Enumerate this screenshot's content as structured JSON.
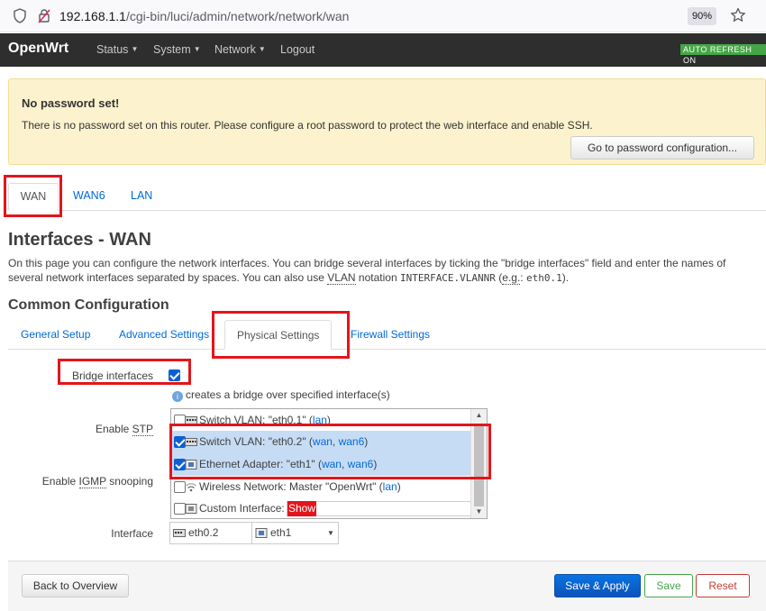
{
  "browser": {
    "url_host": "192.168.1.1",
    "url_path": "/cgi-bin/luci/admin/network/network/wan",
    "zoom": "90%"
  },
  "nav": {
    "brand": "OpenWrt",
    "menu": [
      "Status",
      "System",
      "Network",
      "Logout"
    ],
    "auto_refresh": "AUTO REFRESH ON"
  },
  "alert": {
    "title": "No password set!",
    "message": "There is no password set on this router. Please configure a root password to protect the web interface and enable SSH.",
    "button": "Go to password configuration..."
  },
  "interface_tabs": [
    "WAN",
    "WAN6",
    "LAN"
  ],
  "page": {
    "title": "Interfaces - WAN",
    "desc_1": "On this page you can configure the network interfaces. You can bridge several interfaces by ticking the \"bridge interfaces\" field and enter the names of",
    "desc_2a": "several network interfaces separated by spaces. You can also use ",
    "desc_vlan": "VLAN",
    "desc_2b": " notation ",
    "desc_code": "INTERFACE.VLANNR",
    "desc_2c": " (",
    "desc_eg": "e.g.",
    "desc_2d": ": ",
    "desc_example": "eth0.1",
    "desc_2e": ")."
  },
  "section": {
    "title": "Common Configuration",
    "tabs": [
      "General Setup",
      "Advanced Settings",
      "Physical Settings",
      "Firewall Settings"
    ]
  },
  "form": {
    "bridge_label": "Bridge interfaces",
    "bridge_checked": true,
    "bridge_hint": "creates a bridge over specified interface(s)",
    "stp_label_a": "Enable ",
    "stp_label_abbr": "STP",
    "igmp_label_a": "Enable ",
    "igmp_label_abbr": "IGMP",
    "igmp_label_b": " snooping",
    "interface_label": "Interface",
    "interface_list": [
      {
        "text": "Switch VLAN: \"eth0.1\" (",
        "links": [
          "lan"
        ],
        "checked": false,
        "selected": false
      },
      {
        "text": "Switch VLAN: \"eth0.2\" (",
        "links": [
          "wan",
          "wan6"
        ],
        "checked": true,
        "selected": true
      },
      {
        "text": "Ethernet Adapter: \"eth1\" (",
        "links": [
          "wan",
          "wan6"
        ],
        "checked": true,
        "selected": true
      },
      {
        "text": "Wireless Network: Master \"OpenWrt\" (",
        "links": [
          "lan"
        ],
        "checked": false,
        "selected": false
      }
    ],
    "custom_label": "Custom Interface:",
    "custom_show": "Show",
    "selected_interfaces": [
      "eth0.2",
      "eth1"
    ]
  },
  "footer": {
    "back": "Back to Overview",
    "save_apply": "Save & Apply",
    "save": "Save",
    "reset": "Reset"
  }
}
